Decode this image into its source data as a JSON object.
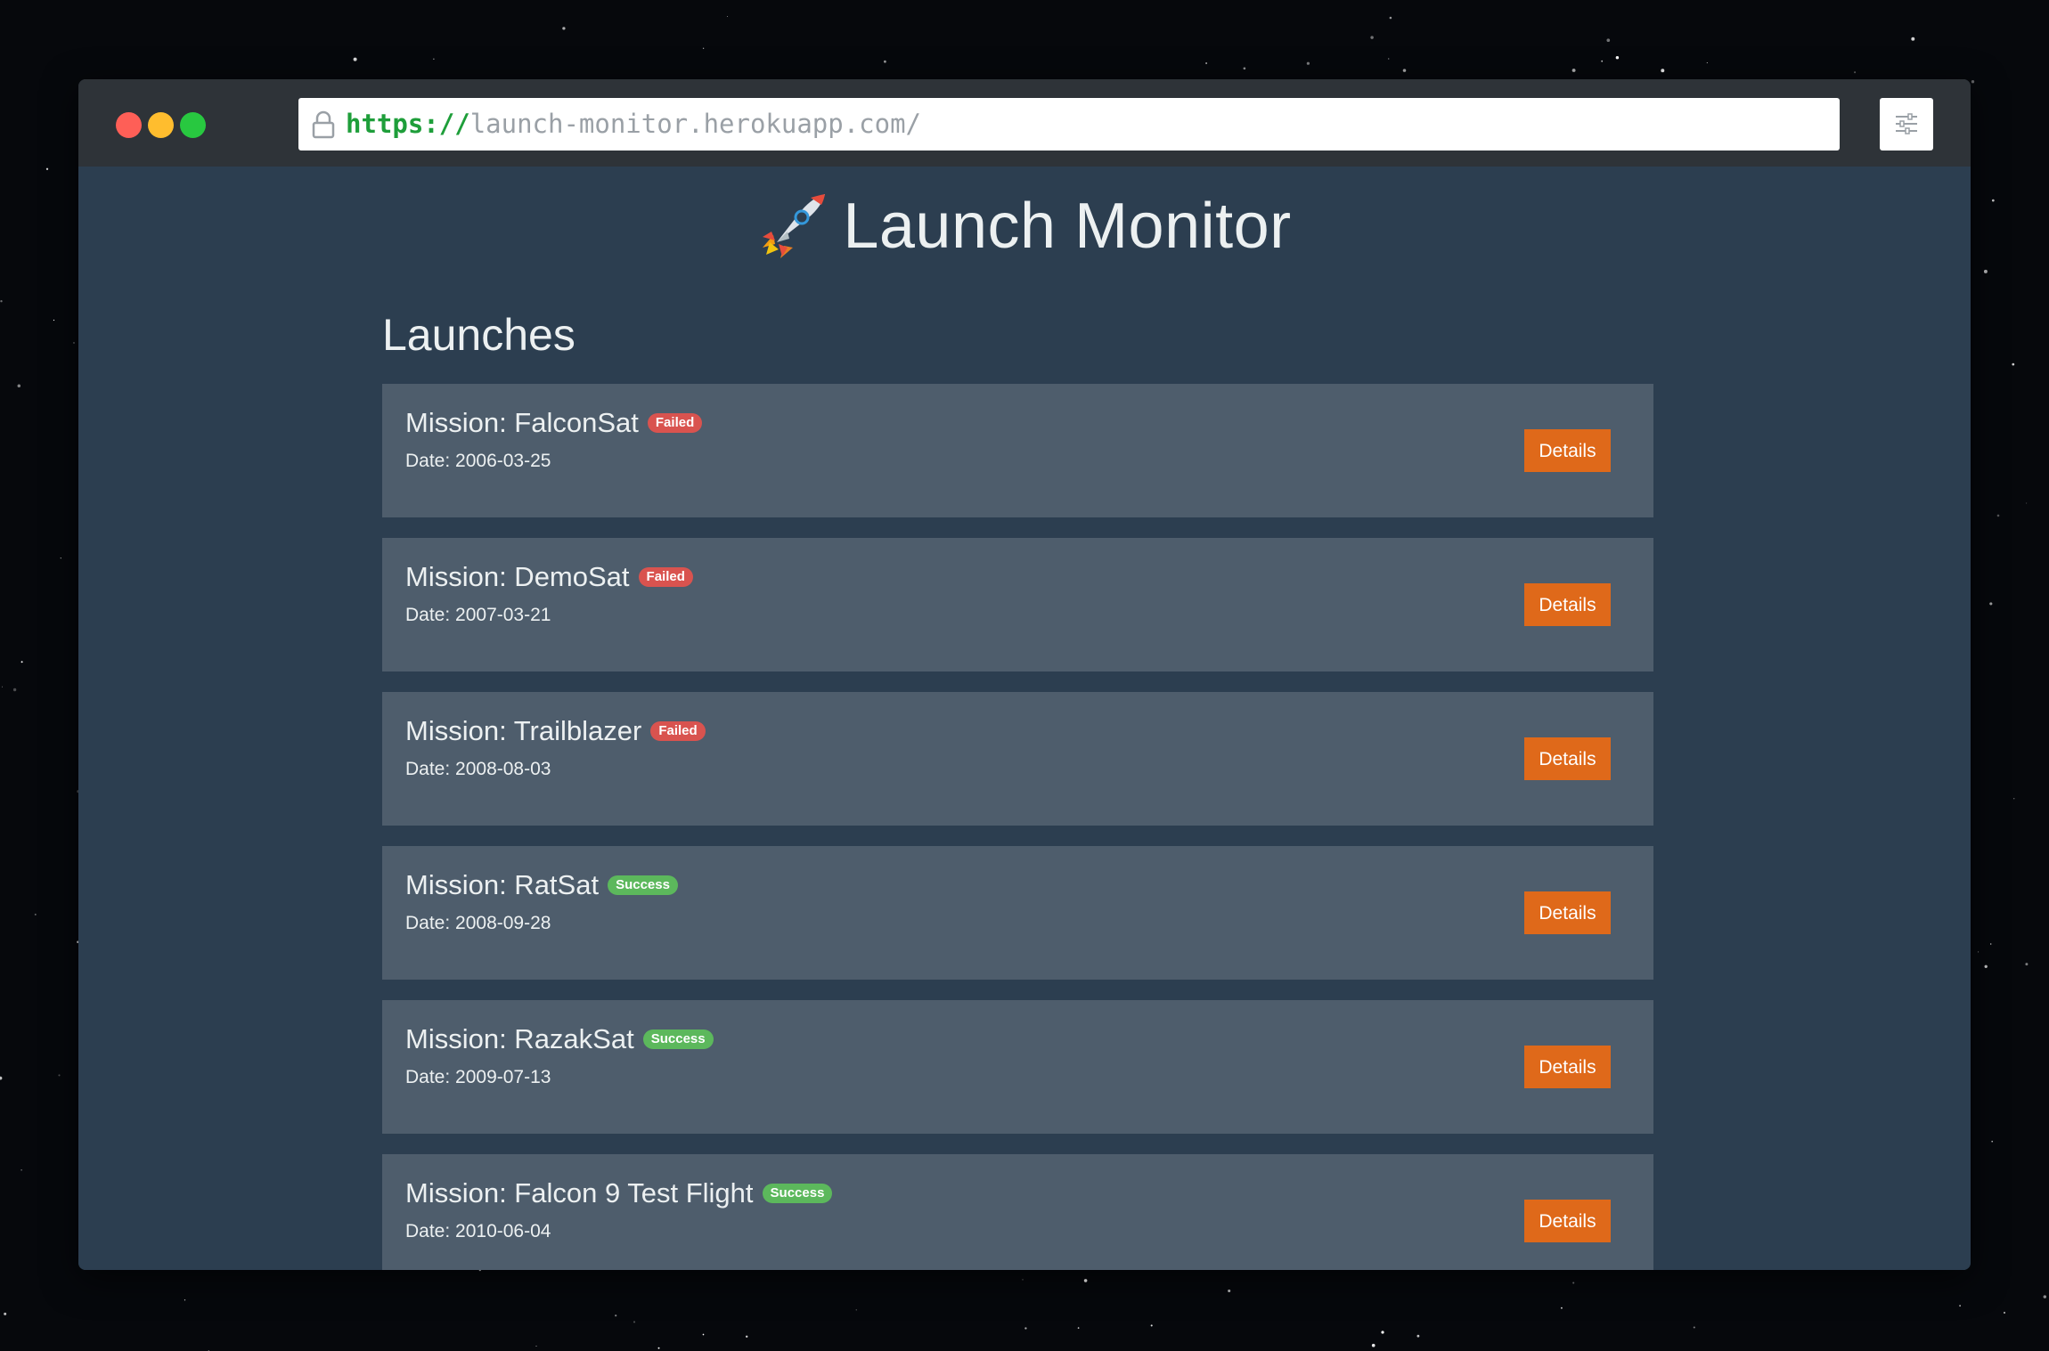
{
  "browser": {
    "url_scheme": "https://",
    "url_host": "launch-monitor.herokuapp.com/",
    "traffic_lights": [
      "#fe5f57",
      "#ffbd2e",
      "#28c840"
    ]
  },
  "header": {
    "title": "Launch Monitor",
    "icon": "rocket-icon"
  },
  "section": {
    "title": "Launches"
  },
  "launches": [
    {
      "mission_label": "Mission: FalconSat",
      "status": "Failed",
      "date_label": "Date: 2006-03-25",
      "details_label": "Details"
    },
    {
      "mission_label": "Mission: DemoSat",
      "status": "Failed",
      "date_label": "Date: 2007-03-21",
      "details_label": "Details"
    },
    {
      "mission_label": "Mission: Trailblazer",
      "status": "Failed",
      "date_label": "Date: 2008-08-03",
      "details_label": "Details"
    },
    {
      "mission_label": "Mission: RatSat",
      "status": "Success",
      "date_label": "Date: 2008-09-28",
      "details_label": "Details"
    },
    {
      "mission_label": "Mission: RazakSat",
      "status": "Success",
      "date_label": "Date: 2009-07-13",
      "details_label": "Details"
    },
    {
      "mission_label": "Mission: Falcon 9 Test Flight",
      "status": "Success",
      "date_label": "Date: 2010-06-04",
      "details_label": "Details"
    }
  ],
  "colors": {
    "background": "#2c3e50",
    "card": "#4e5d6c",
    "accent": "#df691a",
    "failed": "#d9534f",
    "success": "#5cb85c"
  }
}
